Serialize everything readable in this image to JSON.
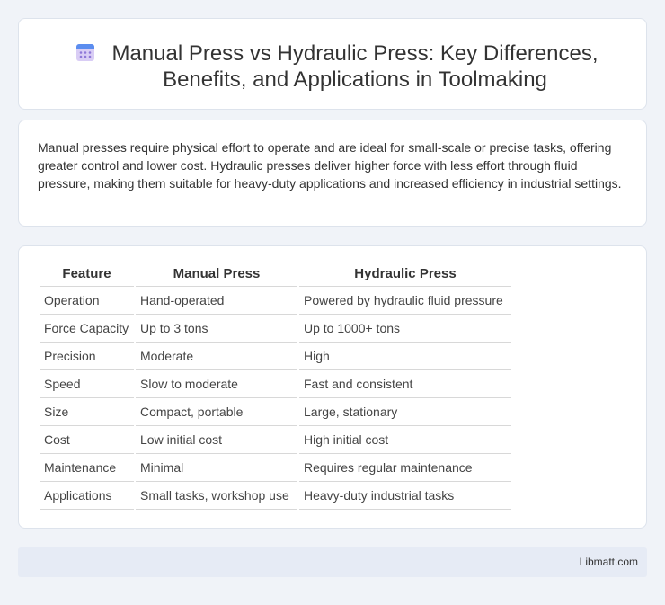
{
  "header": {
    "title": "Manual Press vs Hydraulic Press: Key Differences, Benefits, and Applications in Toolmaking",
    "icon": "calendar-icon"
  },
  "summary": {
    "text": "Manual presses require physical effort to operate and are ideal for small-scale or precise tasks, offering greater control and lower cost. Hydraulic presses deliver higher force with less effort through fluid pressure, making them suitable for heavy-duty applications and increased efficiency in industrial settings."
  },
  "table": {
    "headers": [
      "Feature",
      "Manual Press",
      "Hydraulic Press"
    ],
    "rows": [
      [
        "Operation",
        "Hand-operated",
        "Powered by hydraulic fluid pressure"
      ],
      [
        "Force Capacity",
        "Up to 3 tons",
        "Up to 1000+ tons"
      ],
      [
        "Precision",
        "Moderate",
        "High"
      ],
      [
        "Speed",
        "Slow to moderate",
        "Fast and consistent"
      ],
      [
        "Size",
        "Compact, portable",
        "Large, stationary"
      ],
      [
        "Cost",
        "Low initial cost",
        "High initial cost"
      ],
      [
        "Maintenance",
        "Minimal",
        "Requires regular maintenance"
      ],
      [
        "Applications",
        "Small tasks, workshop use",
        "Heavy-duty industrial tasks"
      ]
    ]
  },
  "footer": {
    "text": "Libmatt.com"
  },
  "colors": {
    "background": "#f0f3f8",
    "card": "#ffffff",
    "footer": "#e6ebf5",
    "icon_top": "#5b8def",
    "icon_body": "#c9b8f0"
  }
}
